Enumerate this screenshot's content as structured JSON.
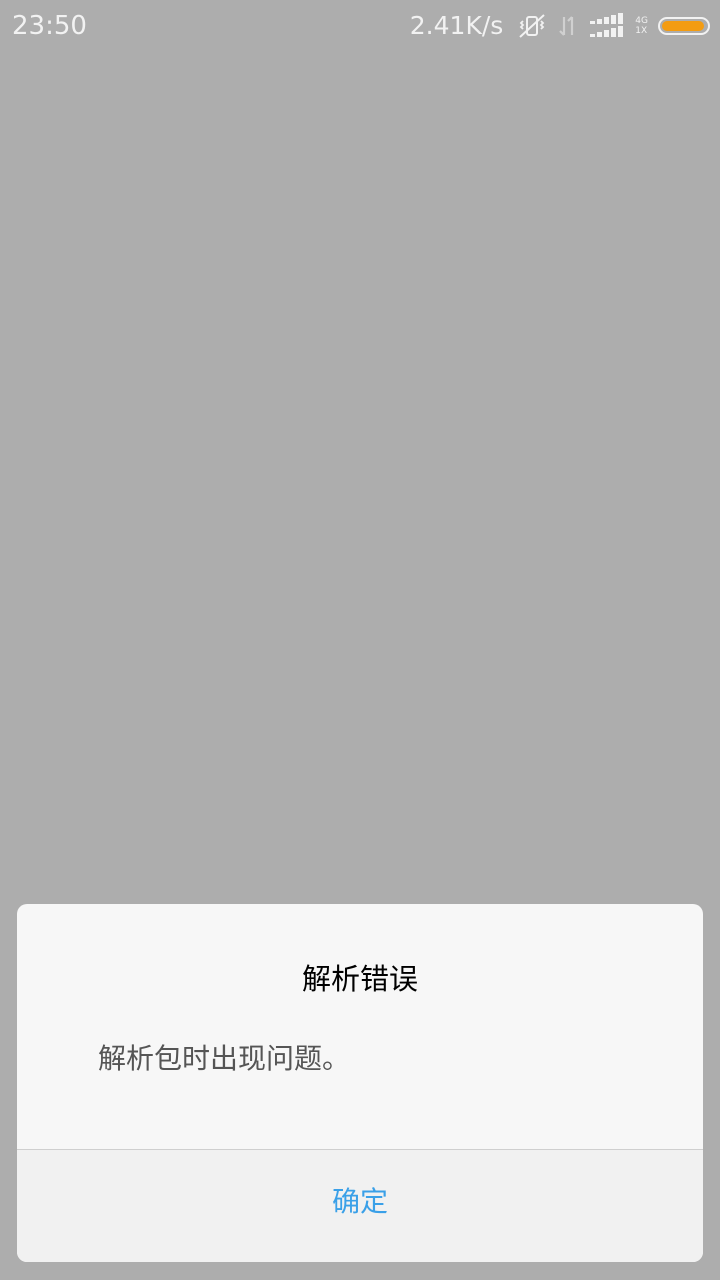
{
  "status_bar": {
    "time": "23:50",
    "net_speed": "2.41K/s",
    "net_type_top": "4G",
    "net_type_bottom": "1X",
    "battery_level": 0.95,
    "battery_color": "#f39c12",
    "icons": [
      "vibrate-off-icon",
      "data-transfer-icon",
      "signal-icon",
      "battery-icon"
    ]
  },
  "dialog": {
    "title": "解析错误",
    "message": "解析包时出现问题。",
    "confirm_label": "确定",
    "accent_color": "#3aa0e8"
  }
}
